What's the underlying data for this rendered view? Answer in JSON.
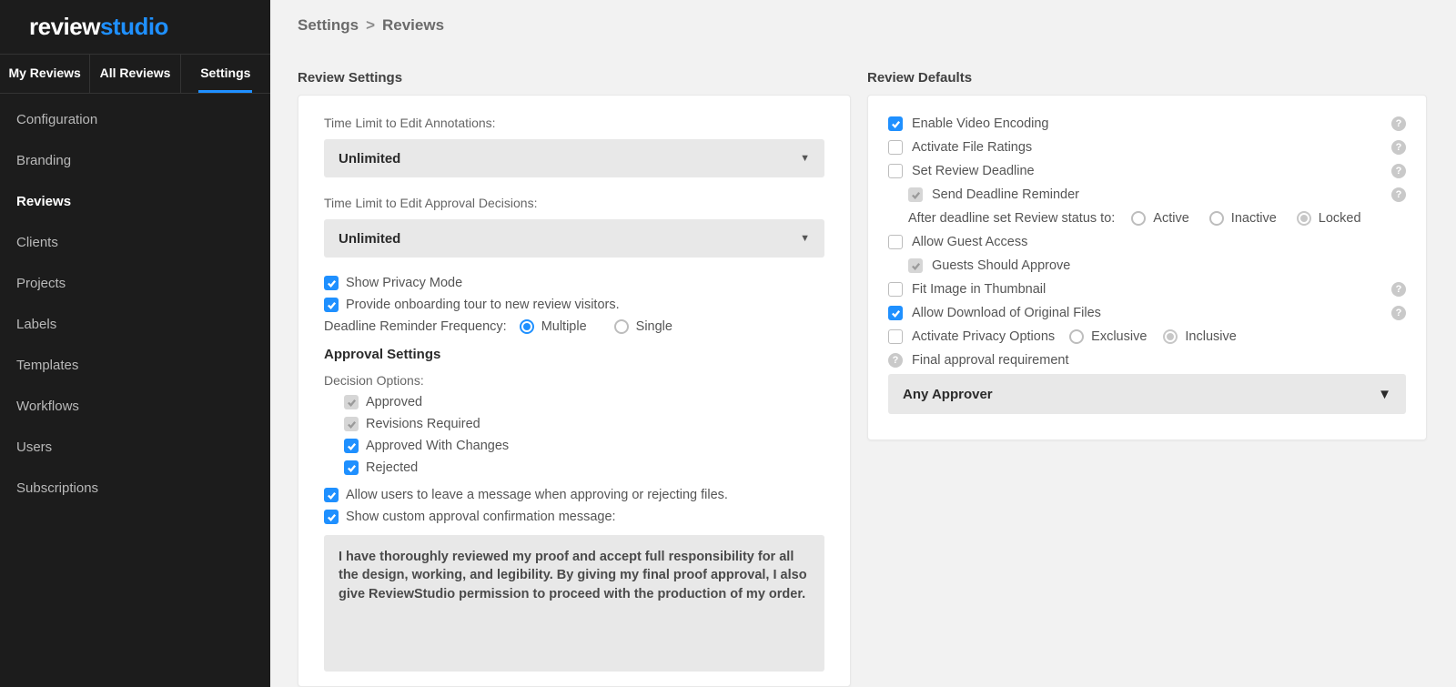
{
  "logo": {
    "part1": "review",
    "part2": "studio"
  },
  "topTabs": {
    "myReviews": "My Reviews",
    "allReviews": "All Reviews",
    "settings": "Settings",
    "activeIndex": 2
  },
  "sideNav": {
    "items": [
      "Configuration",
      "Branding",
      "Reviews",
      "Clients",
      "Projects",
      "Labels",
      "Templates",
      "Workflows",
      "Users",
      "Subscriptions"
    ],
    "activeIndex": 2
  },
  "breadcrumb": {
    "root": "Settings",
    "sep": ">",
    "leaf": "Reviews"
  },
  "left": {
    "title": "Review Settings",
    "annotationLimitLabel": "Time Limit to Edit Annotations:",
    "annotationLimitValue": "Unlimited",
    "approvalLimitLabel": "Time Limit to Edit Approval Decisions:",
    "approvalLimitValue": "Unlimited",
    "privacyMode": {
      "label": "Show Privacy Mode",
      "checked": true
    },
    "onboarding": {
      "label": "Provide onboarding tour to new review visitors.",
      "checked": true
    },
    "reminderFreq": {
      "label": "Deadline Reminder Frequency:",
      "opts": {
        "multiple": "Multiple",
        "single": "Single"
      },
      "selected": "multiple"
    },
    "approvalHeading": "Approval Settings",
    "decisionLabel": "Decision Options:",
    "decisions": {
      "approved": {
        "label": "Approved",
        "state": "locked"
      },
      "revisions": {
        "label": "Revisions Required",
        "state": "locked"
      },
      "changes": {
        "label": "Approved With Changes",
        "state": "checked"
      },
      "rejected": {
        "label": "Rejected",
        "state": "checked"
      }
    },
    "allowMsg": {
      "label": "Allow users to leave a message when approving or rejecting files.",
      "checked": true
    },
    "showCustom": {
      "label": "Show custom approval confirmation message:",
      "checked": true
    },
    "customMsg": "I have thoroughly reviewed my proof and accept full responsibility for all the design, working, and legibility. By giving my final proof approval, I also give ReviewStudio permission to proceed with the production of my order."
  },
  "right": {
    "title": "Review Defaults",
    "videoEnc": {
      "label": "Enable Video Encoding",
      "checked": true,
      "help": true
    },
    "fileRatings": {
      "label": "Activate File Ratings",
      "checked": false,
      "help": true
    },
    "setDeadline": {
      "label": "Set Review Deadline",
      "checked": false,
      "help": true
    },
    "sendReminder": {
      "label": "Send Deadline Reminder",
      "state": "locked",
      "help": true
    },
    "deadlineStatus": {
      "label": "After deadline set Review status to:",
      "opts": {
        "active": "Active",
        "inactive": "Inactive",
        "locked": "Locked"
      },
      "selected": "locked",
      "lockedSelection": true
    },
    "guestAccess": {
      "label": "Allow Guest Access",
      "checked": false
    },
    "guestsApprove": {
      "label": "Guests Should Approve",
      "state": "locked"
    },
    "fitThumb": {
      "label": "Fit Image in Thumbnail",
      "checked": false,
      "help": true
    },
    "download": {
      "label": "Allow Download of Original Files",
      "checked": true,
      "help": true
    },
    "privacy": {
      "label": "Activate Privacy Options",
      "checked": false,
      "modes": {
        "exclusive": "Exclusive",
        "inclusive": "Inclusive"
      },
      "selected": "inclusive",
      "lockedSelection": true
    },
    "finalReq": {
      "label": "Final approval requirement",
      "help": true,
      "value": "Any Approver"
    }
  }
}
